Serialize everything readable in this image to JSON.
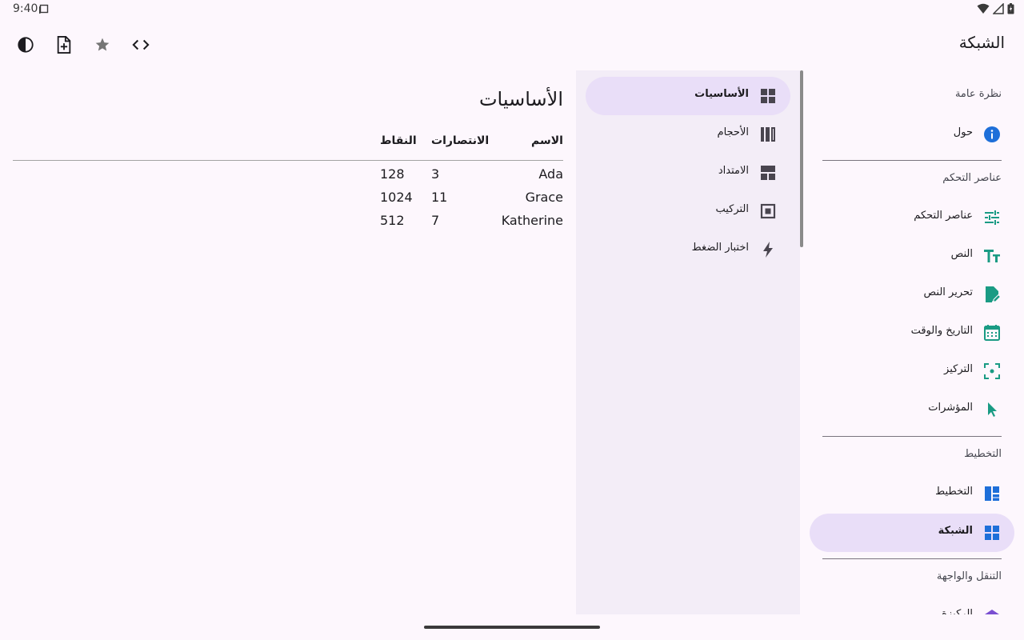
{
  "status_bar": {
    "time": "9:40"
  },
  "app_bar": {
    "title": "الشبكة",
    "tools": [
      {
        "name": "theme-toggle-button",
        "icon": "contrast-icon"
      },
      {
        "name": "new-file-button",
        "icon": "note-add-icon"
      },
      {
        "name": "favorite-button",
        "icon": "star-icon"
      },
      {
        "name": "code-button",
        "icon": "code-icon"
      }
    ]
  },
  "main_nav": {
    "sections": [
      {
        "title": "نظرة عامة"
      },
      {
        "title": "عناصر التحكم"
      },
      {
        "title": "التخطيط"
      },
      {
        "title": "التنقل والواجهة"
      }
    ],
    "items": [
      {
        "label": "حول",
        "icon": "info-icon",
        "color": "#1e6fd9"
      },
      {
        "label": "عناصر التحكم",
        "icon": "tune-icon",
        "color": "#1a9b84"
      },
      {
        "label": "النص",
        "icon": "text-fields-icon",
        "color": "#1a9b84"
      },
      {
        "label": "تحرير النص",
        "icon": "edit-document-icon",
        "color": "#1a9b84"
      },
      {
        "label": "التاريخ والوقت",
        "icon": "calendar-icon",
        "color": "#1a9b84"
      },
      {
        "label": "التركيز",
        "icon": "focus-icon",
        "color": "#1a9b84"
      },
      {
        "label": "المؤشرات",
        "icon": "cursor-icon",
        "color": "#1a9b84"
      },
      {
        "label": "التخطيط",
        "icon": "dashboard-icon",
        "color": "#1e6fd9"
      },
      {
        "label": "الشبكة",
        "icon": "grid-icon",
        "color": "#1e6fd9",
        "selected": true
      },
      {
        "label": "الركيزة",
        "icon": "stack-icon",
        "color": "#7a4fd1"
      }
    ]
  },
  "sub_nav": {
    "items": [
      {
        "label": "الأساسيات",
        "icon": "grid-icon",
        "selected": true
      },
      {
        "label": "الأحجام",
        "icon": "columns-icon"
      },
      {
        "label": "الامتداد",
        "icon": "span-icon"
      },
      {
        "label": "التركيب",
        "icon": "nested-icon"
      },
      {
        "label": "اختبار الضغط",
        "icon": "bolt-icon"
      }
    ]
  },
  "content": {
    "title": "الأساسيات",
    "columns": [
      "الاسم",
      "الانتصارات",
      "النقاط"
    ],
    "rows": [
      [
        "Ada",
        "3",
        "128"
      ],
      [
        "Grace",
        "11",
        "1024"
      ],
      [
        "Katherine",
        "7",
        "512"
      ]
    ]
  },
  "colors": {
    "background": "#fdf7fd",
    "selected": "#e9def8",
    "sub_nav_bg": "#f3edf7"
  }
}
